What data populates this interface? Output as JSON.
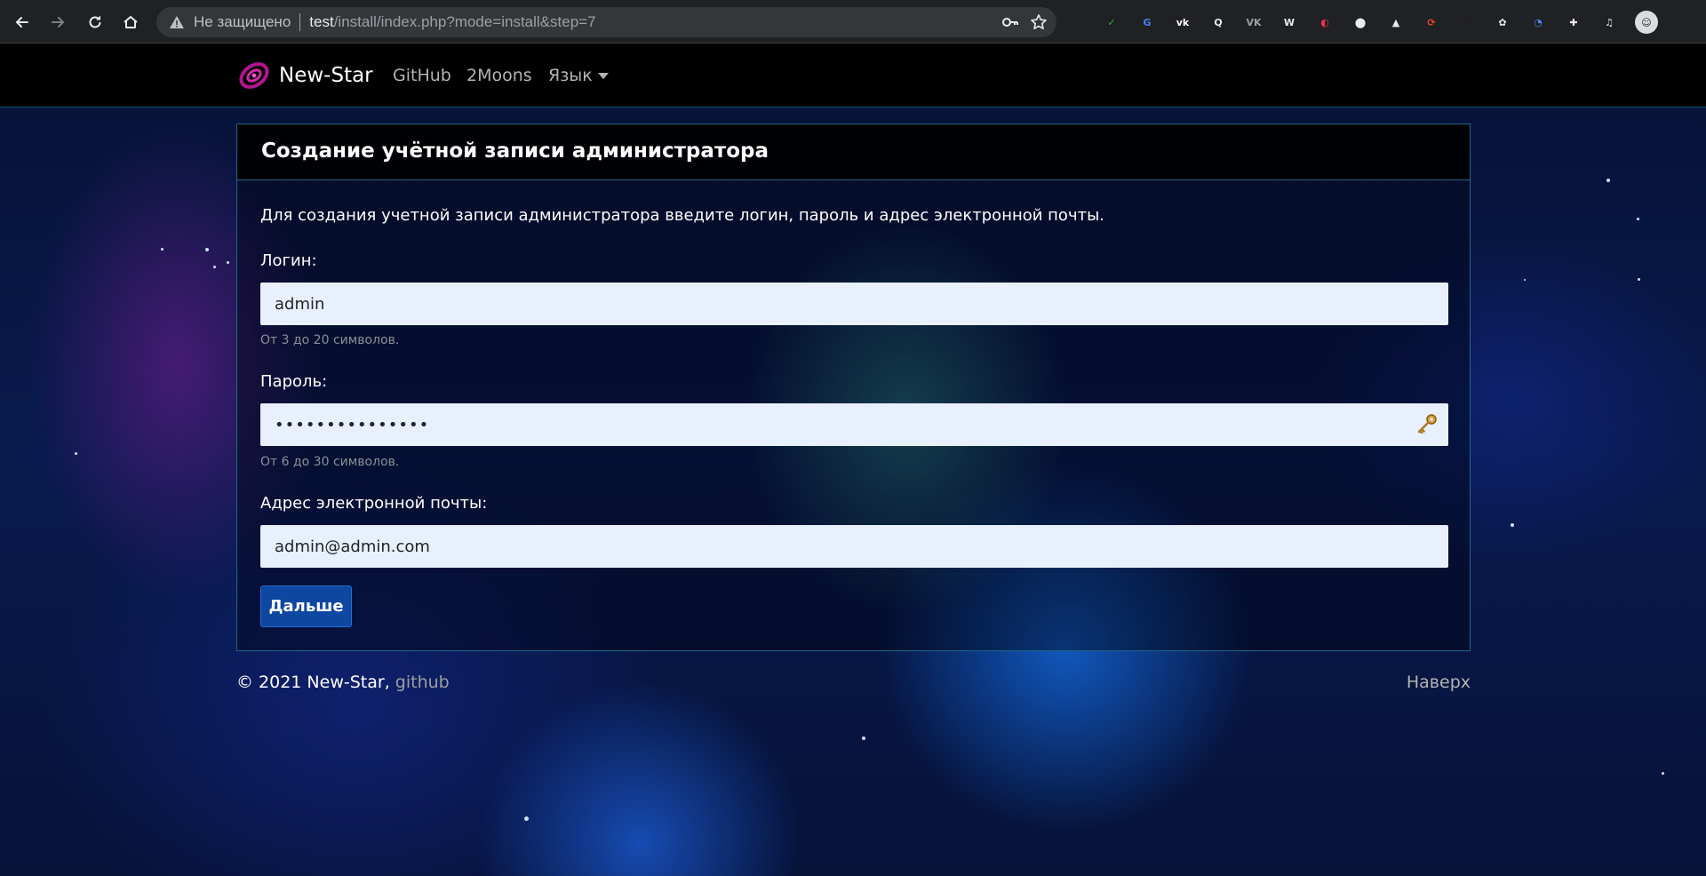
{
  "browser": {
    "security_label": "Не защищено",
    "url_host": "test",
    "url_path": "/install/index.php?mode=install&step=7",
    "extensions": [
      {
        "name": "shield-extension",
        "glyph": "✓",
        "color": "#34a853"
      },
      {
        "name": "google-translate-extension",
        "glyph": "G",
        "color": "#4285f4"
      },
      {
        "name": "vk-extension",
        "glyph": "vk",
        "color": "#ffffff"
      },
      {
        "name": "search-extension",
        "glyph": "Q",
        "color": "#e8eaed"
      },
      {
        "name": "vk-play-extension",
        "glyph": "VK",
        "color": "#9aa0a6"
      },
      {
        "name": "w-circle-extension",
        "glyph": "W",
        "color": "#e8eaed"
      },
      {
        "name": "color-picker-extension",
        "glyph": "◐",
        "color": "#e8334a"
      },
      {
        "name": "github-extension",
        "glyph": "⬤",
        "color": "#e8eaed"
      },
      {
        "name": "bookmark-extension",
        "glyph": "▲",
        "color": "#e8eaed"
      },
      {
        "name": "sync-extension",
        "glyph": "⟳",
        "color": "#ea4335"
      },
      {
        "name": "wikipedia-extension",
        "glyph": "W",
        "color": "#202124"
      },
      {
        "name": "wordpress-extension",
        "glyph": "✿",
        "color": "#e8eaed"
      },
      {
        "name": "lighthouse-extension",
        "glyph": "◔",
        "color": "#4c8bf5"
      },
      {
        "name": "extensions-puzzle",
        "glyph": "✚",
        "color": "#e8eaed"
      },
      {
        "name": "media-control",
        "glyph": "♫",
        "color": "#e8eaed"
      }
    ]
  },
  "nav": {
    "brand": "New-Star",
    "links": [
      "GitHub",
      "2Moons"
    ],
    "language_label": "Язык"
  },
  "card": {
    "title": "Создание учётной записи администратора",
    "intro": "Для создания учетной записи администратора введите логин, пароль и адрес электронной почты.",
    "login": {
      "label": "Логин:",
      "value": "admin",
      "hint": "От 3 до 20 символов."
    },
    "password": {
      "label": "Пароль:",
      "value": "•••••••••••••••",
      "hint": "От 6 до 30 символов."
    },
    "email": {
      "label": "Адрес электронной почты:",
      "value": "admin@admin.com"
    },
    "submit_label": "Дальше"
  },
  "footer": {
    "copyright": "© 2021 New-Star, ",
    "github_link": "github",
    "to_top": "Наверх"
  },
  "colors": {
    "accent_button": "#0d47a1",
    "input_bg": "#e8f0fe",
    "card_border": "#1b6a86"
  }
}
